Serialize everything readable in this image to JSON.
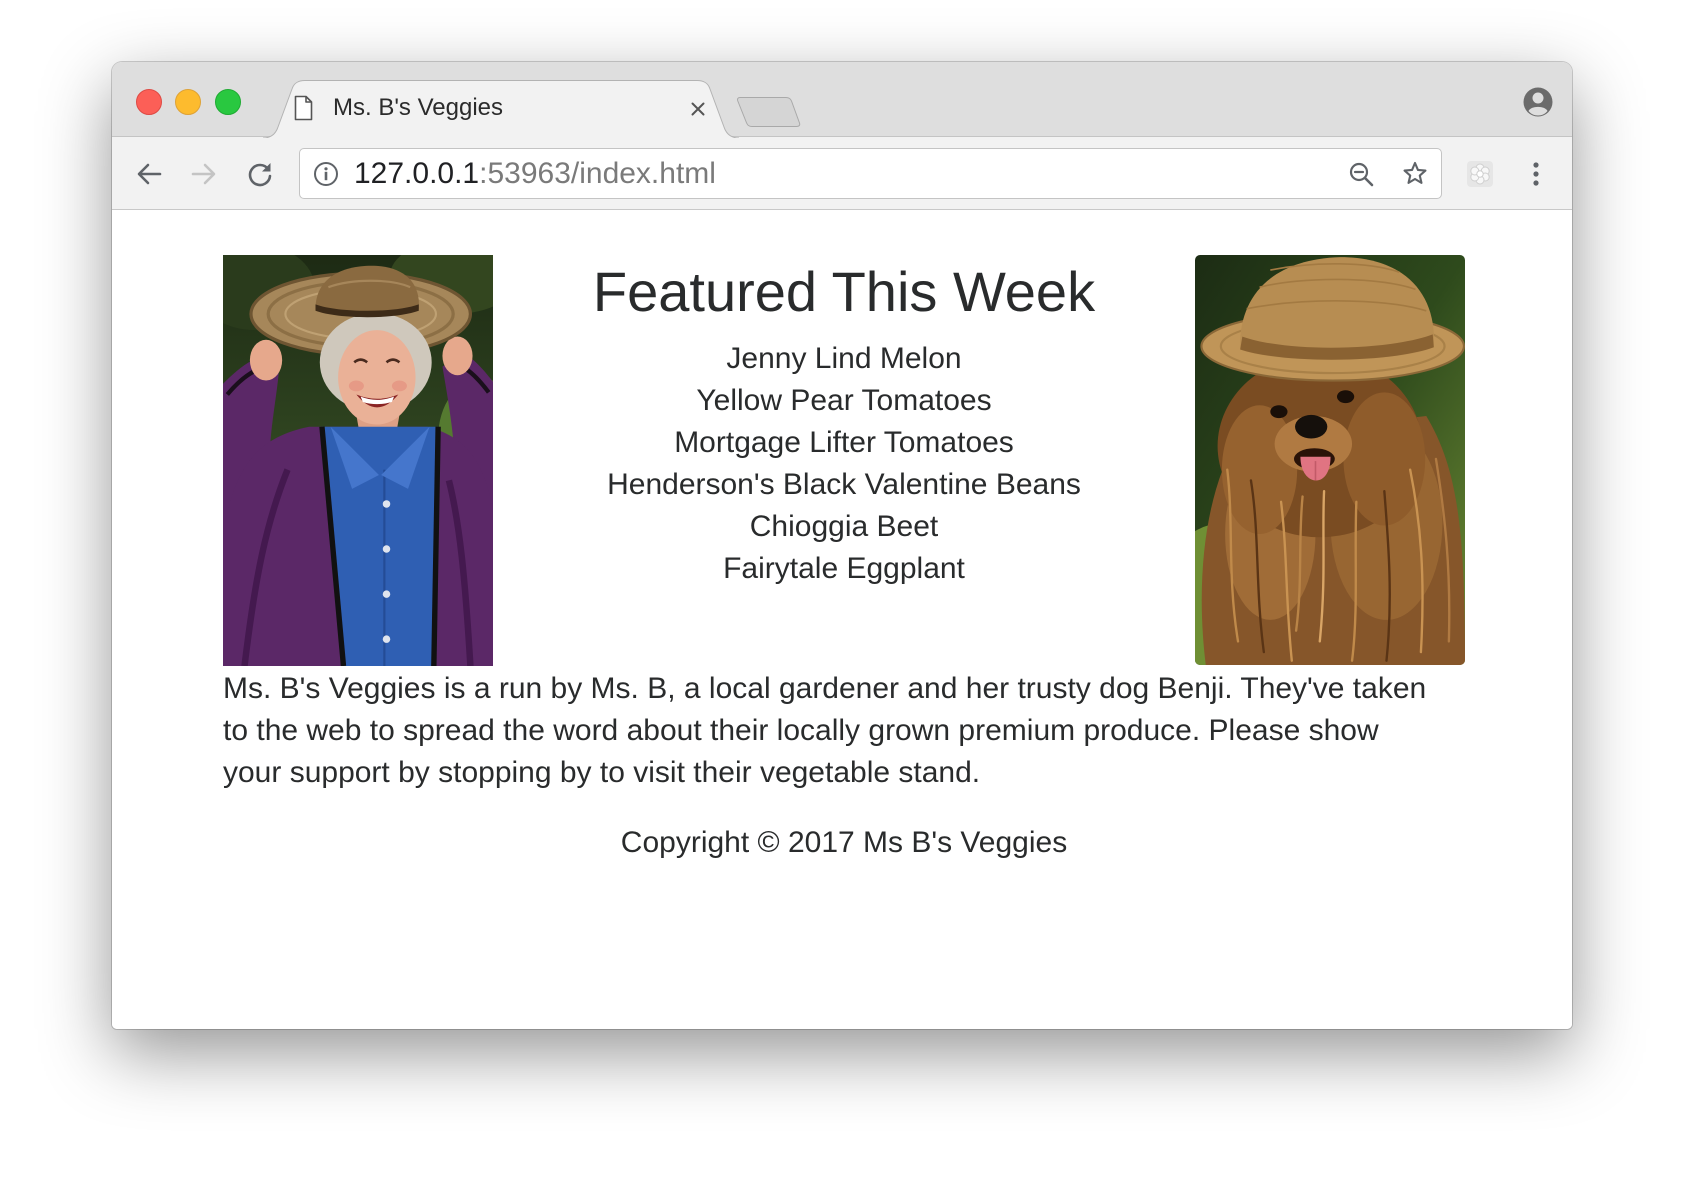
{
  "browser": {
    "tab_title": "Ms. B's Veggies",
    "url_host": "127.0.0.1",
    "url_path": ":53963/index.html"
  },
  "page": {
    "featured_heading": "Featured This Week",
    "featured_items": [
      "Jenny Lind Melon",
      "Yellow Pear Tomatoes",
      "Mortgage Lifter Tomatoes",
      "Henderson's Black Valentine Beans",
      "Chioggia Beet",
      "Fairytale Eggplant"
    ],
    "about": "Ms. B's Veggies is a run by Ms. B, a local gardener and her trusty dog Benji. They've taken to the web to spread the word about their locally grown premium produce. Please show your support by stopping by to visit their vegetable stand.",
    "copyright": "Copyright © 2017 Ms B's Veggies"
  },
  "icons": {
    "tab_favicon": "document-icon",
    "tab_close": "close-icon",
    "new_tab": "new-tab-icon",
    "profile": "account-circle-icon",
    "back": "back-arrow-icon",
    "forward": "forward-arrow-icon",
    "reload": "reload-icon",
    "site_info": "info-icon",
    "zoom": "zoom-out-icon",
    "bookmark": "star-icon",
    "extension": "extension-icon",
    "menu": "more-vert-icon"
  },
  "colors": {
    "tab_strip": "#dedede",
    "toolbar": "#f2f2f2",
    "page_text": "#292b2c",
    "url_host": "#202124",
    "url_path": "#7a7a7a",
    "traffic_close": "#fc5f57",
    "traffic_minimize": "#fdbb2e",
    "traffic_zoom": "#29c840"
  }
}
